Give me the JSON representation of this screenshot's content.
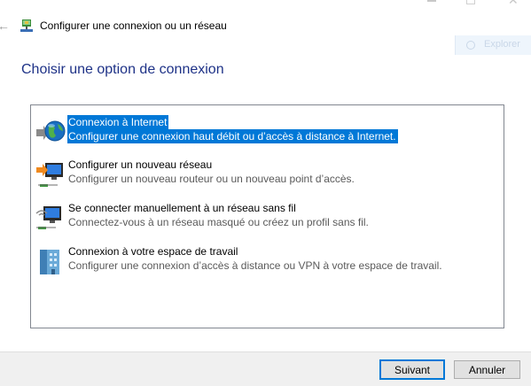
{
  "window": {
    "title": "Configurer une connexion ou un réseau",
    "search_placeholder": "Explorer"
  },
  "main": {
    "heading": "Choisir une option de connexion"
  },
  "options": [
    {
      "title": "Connexion à Internet",
      "description": "Configurer une connexion haut débit ou d’accès à distance à Internet.",
      "icon": "globe-internet-icon",
      "selected": true
    },
    {
      "title": "Configurer un nouveau réseau",
      "description": "Configurer un nouveau routeur ou un nouveau point d’accès.",
      "icon": "new-network-icon",
      "selected": false
    },
    {
      "title": "Se connecter manuellement à un réseau sans fil",
      "description": "Connectez-vous à un réseau masqué ou créez un profil sans fil.",
      "icon": "wireless-network-icon",
      "selected": false
    },
    {
      "title": "Connexion à votre espace de travail",
      "description": "Configurer une connexion d’accès à distance ou VPN à votre espace de travail.",
      "icon": "workplace-building-icon",
      "selected": false
    }
  ],
  "buttons": {
    "next": "Suivant",
    "cancel": "Annuler"
  },
  "colors": {
    "heading": "#1e3287",
    "selection": "#0078d7",
    "footer": "#f0f0f0"
  }
}
